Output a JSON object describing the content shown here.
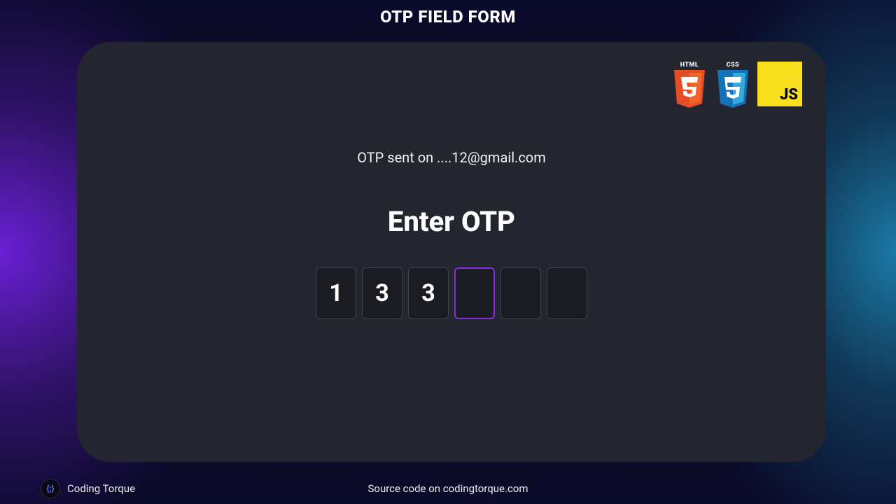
{
  "page_title": "OTP FIELD FORM",
  "tech_badges": {
    "html_label": "HTML",
    "css_label": "CSS",
    "js_label": "JS"
  },
  "otp": {
    "info_text": "OTP sent on ....12@gmail.com",
    "heading": "Enter OTP",
    "digits": [
      "1",
      "3",
      "3",
      "",
      "",
      ""
    ],
    "focused_index": 3
  },
  "footer": {
    "brand_name": "Coding Torque",
    "brand_glyph": "{;}",
    "source_text": "Source code on codingtorque.com"
  },
  "colors": {
    "card_bg": "#23262f",
    "otp_focus_border": "#8a2be2",
    "js_yellow": "#f7df1e",
    "html_orange": "#e44d26",
    "css_blue": "#1572b6"
  }
}
